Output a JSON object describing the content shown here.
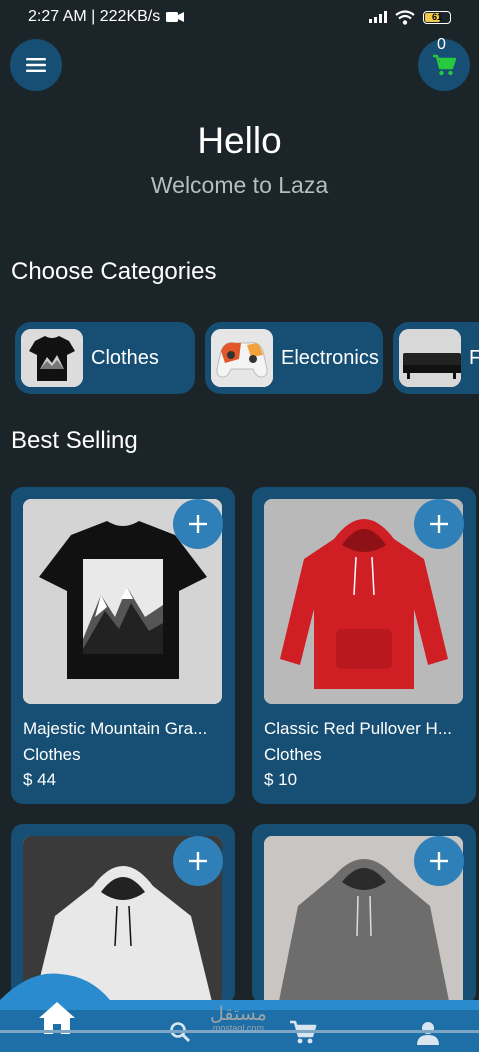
{
  "status_bar": {
    "time_speed": "2:27 AM | 222KB/s",
    "battery": "61"
  },
  "header": {
    "cart_count": "0"
  },
  "greeting": {
    "title": "Hello",
    "subtitle": "Welcome to Laza"
  },
  "categories_section": {
    "title": "Choose Categories",
    "items": [
      {
        "label": "Clothes",
        "icon": "tshirt-thumbnail"
      },
      {
        "label": "Electronics",
        "icon": "game-controller-thumbnail"
      },
      {
        "label": "F",
        "icon": "sofa-thumbnail"
      }
    ]
  },
  "best_selling": {
    "title": "Best Selling",
    "products": [
      {
        "name": "Majestic Mountain Gra...",
        "category": "Clothes",
        "price": "$ 44",
        "image": "black-mountain-tshirt"
      },
      {
        "name": "Classic Red Pullover H...",
        "category": "Clothes",
        "price": "$ 10",
        "image": "red-hoodie"
      },
      {
        "name": "",
        "category": "",
        "price": "",
        "image": "white-hoodie"
      },
      {
        "name": "",
        "category": "",
        "price": "",
        "image": "gray-hoodie"
      }
    ]
  },
  "bottom_nav": {
    "items": [
      "home-icon",
      "search-icon",
      "cart-icon",
      "profile-icon"
    ],
    "active": "home-icon"
  },
  "watermark": {
    "arabic": "مستقل",
    "latin": "mostaql.com"
  },
  "colors": {
    "background": "#1b2428",
    "card": "#164f73",
    "accent": "#2f80b8",
    "cart_icon": "#27c93f"
  }
}
